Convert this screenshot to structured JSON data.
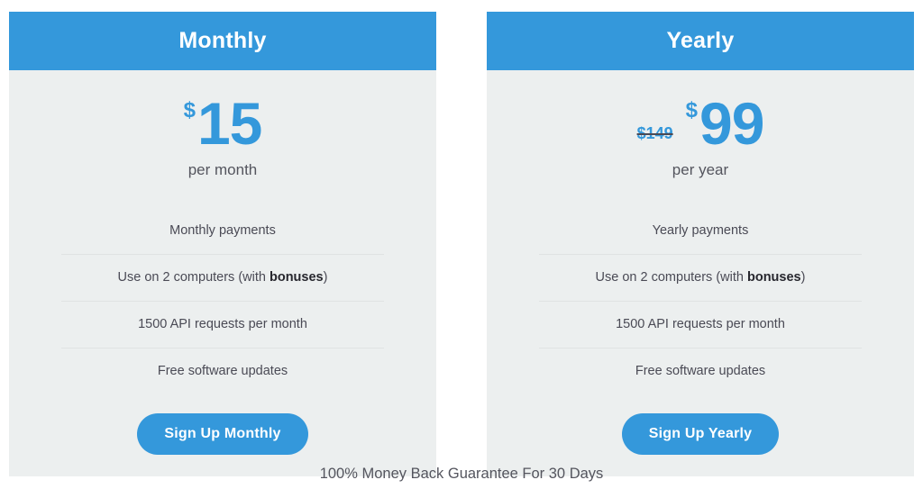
{
  "plans": [
    {
      "title": "Monthly",
      "old_price": "",
      "currency": "$",
      "amount": "15",
      "period": "per month",
      "features": [
        {
          "text": "Monthly payments",
          "bold": ""
        },
        {
          "text": "Use on 2 computers (with ",
          "bold": "bonuses",
          "after": ")"
        },
        {
          "text": "1500 API requests per month",
          "bold": ""
        },
        {
          "text": "Free software updates",
          "bold": ""
        }
      ],
      "cta_label": "Sign Up Monthly"
    },
    {
      "title": "Yearly",
      "old_price": "$149",
      "currency": "$",
      "amount": "99",
      "period": "per year",
      "features": [
        {
          "text": "Yearly payments",
          "bold": ""
        },
        {
          "text": "Use on 2 computers (with ",
          "bold": "bonuses",
          "after": ")"
        },
        {
          "text": "1500 API requests per month",
          "bold": ""
        },
        {
          "text": "Free software updates",
          "bold": ""
        }
      ],
      "cta_label": "Sign Up Yearly"
    }
  ],
  "footer": {
    "guarantee": "100% Money Back Guarantee For 30 Days"
  },
  "colors": {
    "accent": "#3498db",
    "card_background": "#ecefef",
    "text": "#4a4a55",
    "page_background": "#ffffff"
  }
}
